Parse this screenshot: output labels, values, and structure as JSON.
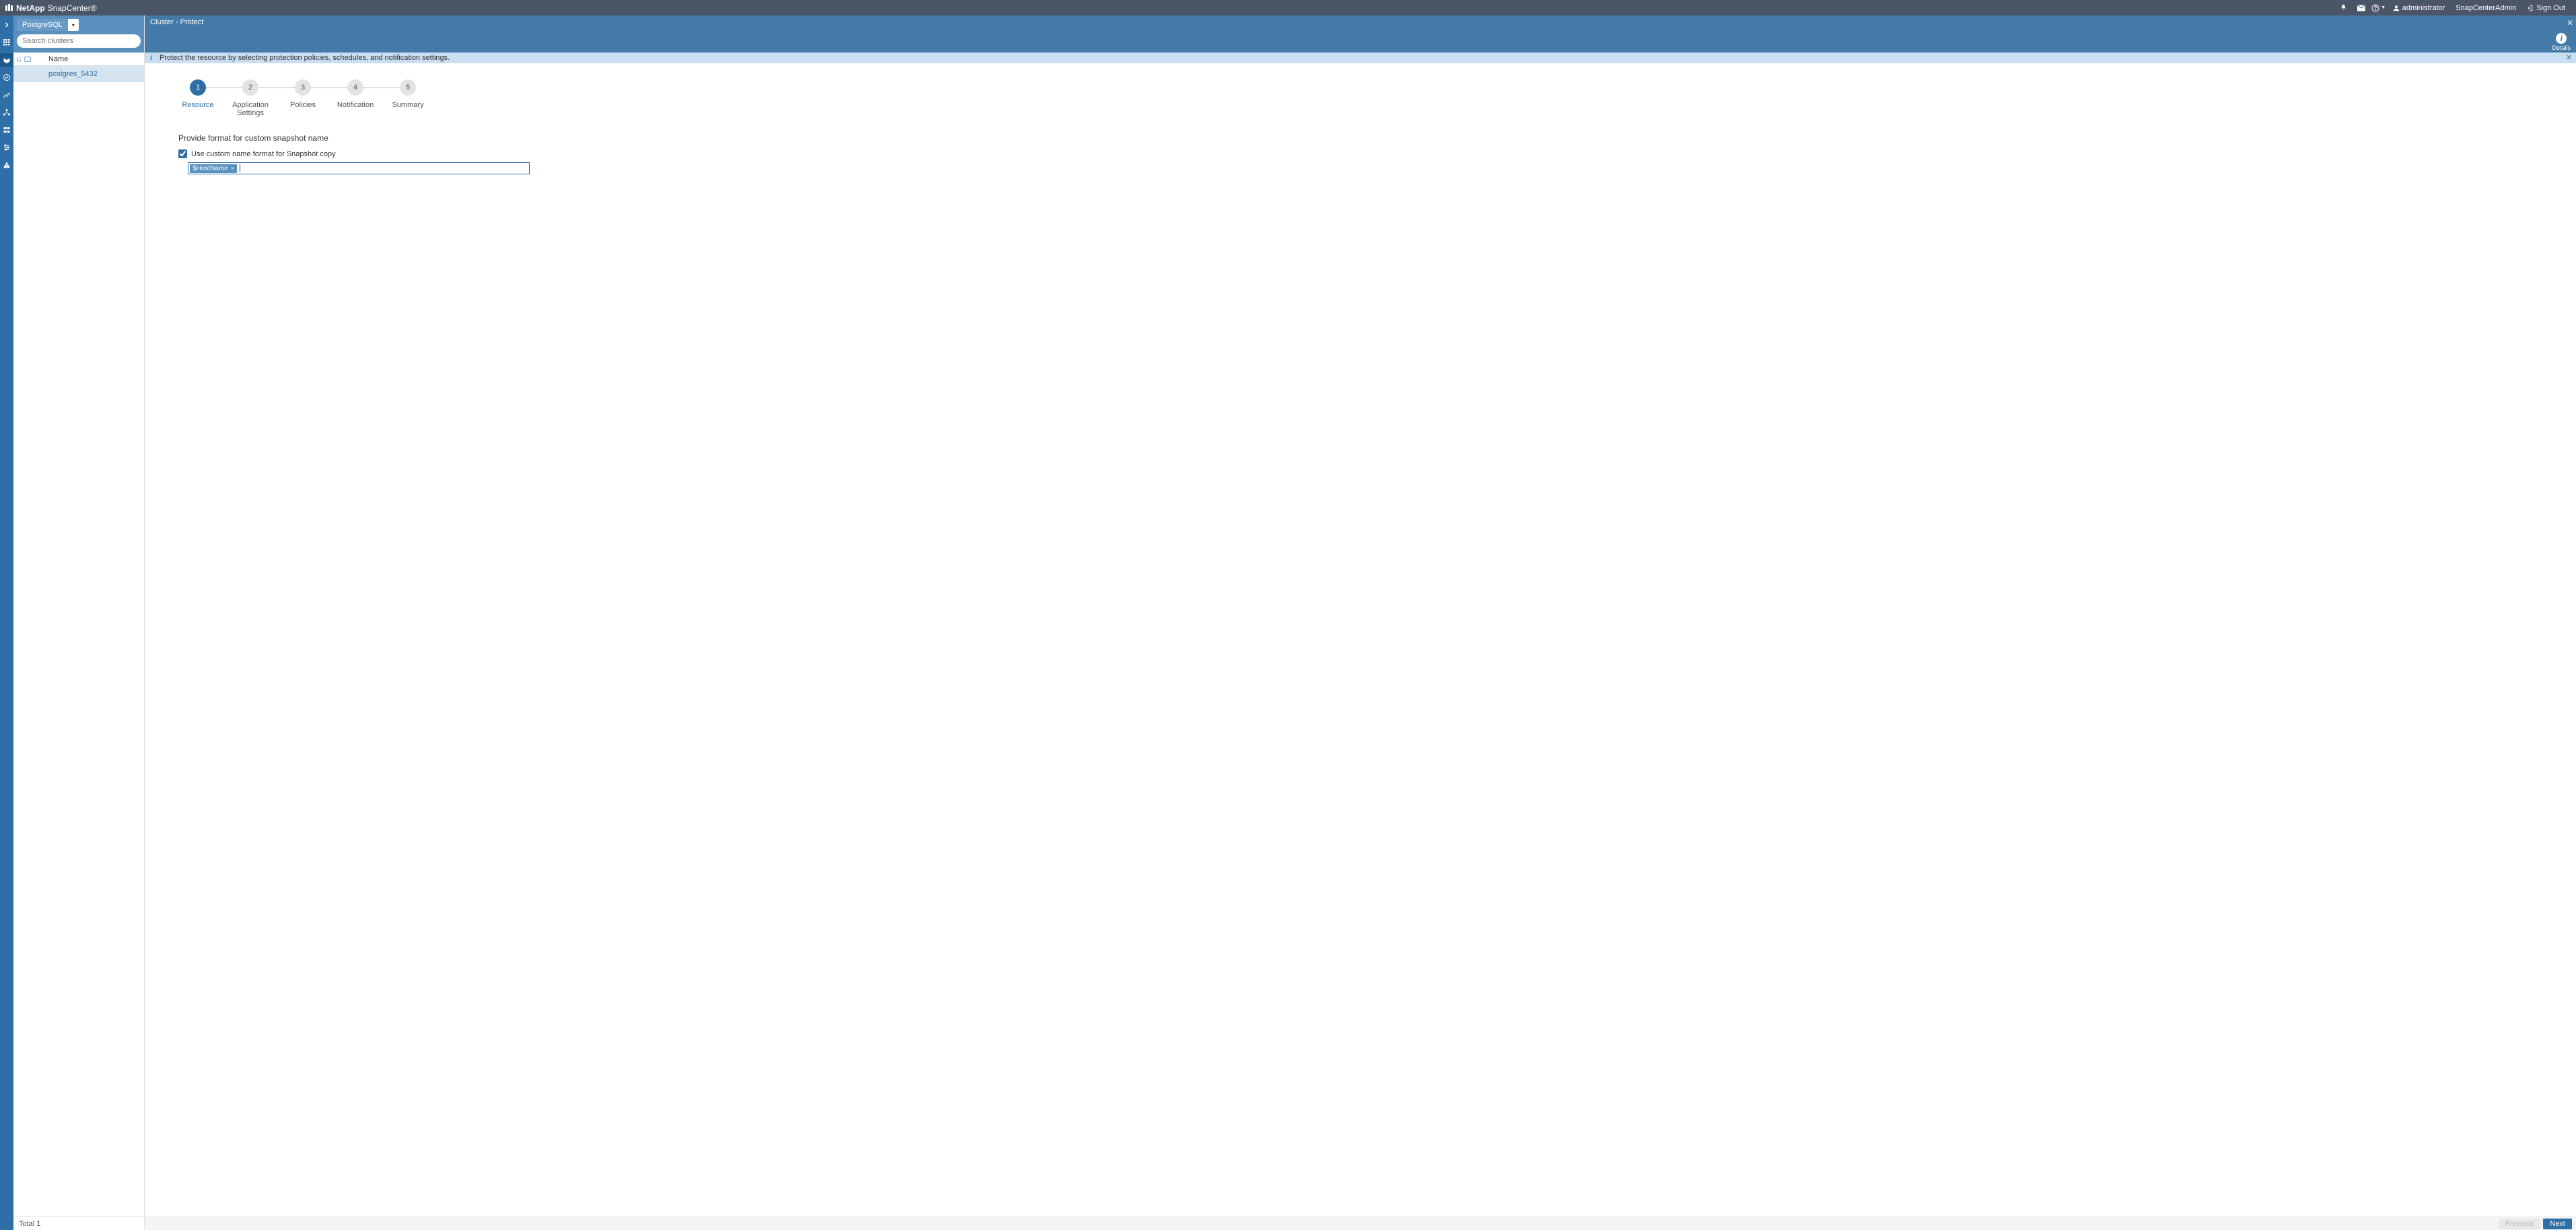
{
  "header": {
    "brand_prefix": "NetApp",
    "brand_product": "SnapCenter®",
    "user_label": "administrator",
    "role_label": "SnapCenterAdmin",
    "signout_label": "Sign Out"
  },
  "sidebar": {
    "plugin_label": "PostgreSQL",
    "search_placeholder": "Search clusters",
    "column_name": "Name",
    "items": [
      {
        "label": "postgres_5432"
      }
    ],
    "total_label": "Total 1"
  },
  "main": {
    "breadcrumb": "Cluster - Protect",
    "details_label": "Details",
    "info_text": "Protect the resource by selecting protection policies, schedules, and notification settings.",
    "steps": [
      {
        "num": "1",
        "label": "Resource",
        "active": true
      },
      {
        "num": "2",
        "label": "Application Settings",
        "active": false
      },
      {
        "num": "3",
        "label": "Policies",
        "active": false
      },
      {
        "num": "4",
        "label": "Notification",
        "active": false
      },
      {
        "num": "5",
        "label": "Summary",
        "active": false
      }
    ],
    "form": {
      "heading": "Provide format for custom snapshot name",
      "checkbox_label": "Use custom name format for Snapshot copy",
      "checkbox_checked": true,
      "tokens": [
        "$HostName"
      ]
    },
    "buttons": {
      "previous": "Previous",
      "next": "Next"
    }
  }
}
